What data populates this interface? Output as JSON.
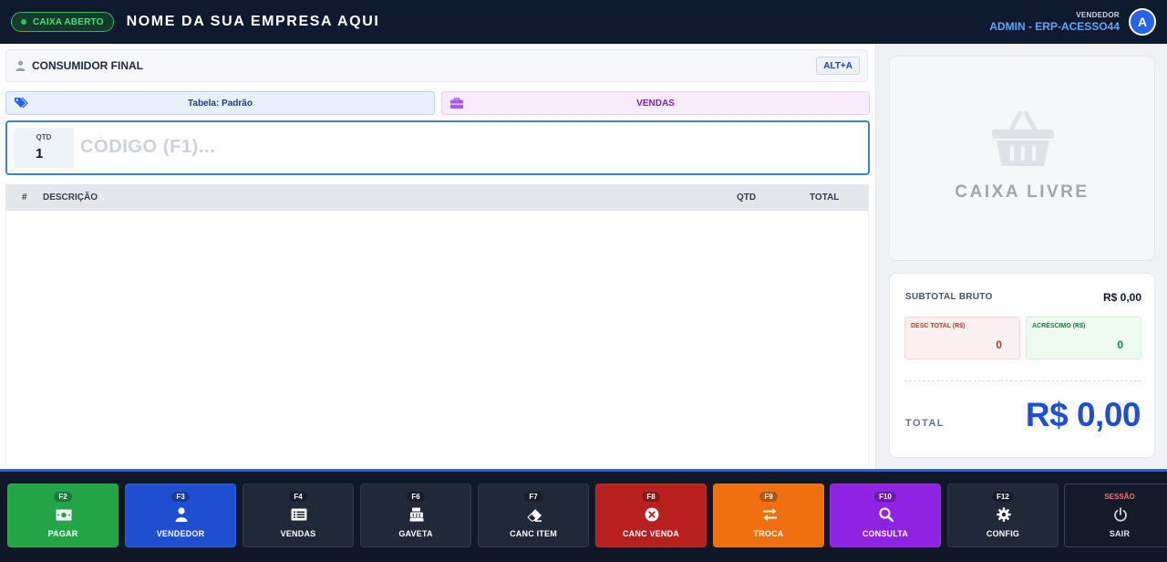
{
  "header": {
    "status_label": "CAIXA ABERTO",
    "company_name": "NOME DA SUA EMPRESA AQUI",
    "user_role": "VENDEDOR",
    "user_name": "ADMIN - ERP-ACESSO44",
    "avatar_initial": "A"
  },
  "customer": {
    "name": "CONSUMIDOR FINAL",
    "shortcut": "ALT+A"
  },
  "price_table": {
    "label": "Tabela: Padrão",
    "icon": "tags-icon"
  },
  "mode": {
    "label": "VENDAS",
    "icon": "briefcase-icon"
  },
  "entry": {
    "qty_label": "QTD",
    "qty_value": "1",
    "code_placeholder": "CÓDIGO (F1)..."
  },
  "items_table": {
    "columns": [
      "#",
      "DESCRIÇÃO",
      "QTD",
      "TOTAL"
    ],
    "rows": []
  },
  "status_panel": {
    "icon": "basket-icon",
    "label": "CAIXA LIVRE"
  },
  "totals": {
    "subtotal_label": "SUBTOTAL BRUTO",
    "subtotal_value": "R$ 0,00",
    "discount_label": "DESC TOTAL (R$)",
    "discount_value": "0",
    "surcharge_label": "ACRÉSCIMO (R$)",
    "surcharge_value": "0",
    "total_label": "TOTAL",
    "total_value": "R$ 0,00"
  },
  "function_keys": [
    {
      "key": "F2",
      "label": "PAGAR",
      "icon": "cash-icon",
      "color": "#22a447"
    },
    {
      "key": "F3",
      "label": "VENDEDOR",
      "icon": "user-icon",
      "color": "#1f4fd1"
    },
    {
      "key": "F4",
      "label": "VENDAS",
      "icon": "list-icon",
      "color": "#1f2937"
    },
    {
      "key": "F6",
      "label": "GAVETA",
      "icon": "cash-register-icon",
      "color": "#1f2937"
    },
    {
      "key": "F7",
      "label": "CANC ITEM",
      "icon": "eraser-icon",
      "color": "#1f2937"
    },
    {
      "key": "F8",
      "label": "CANC VENDA",
      "icon": "x-circle-icon",
      "color": "#b81f1f"
    },
    {
      "key": "F9",
      "label": "TROCA",
      "icon": "exchange-icon",
      "color": "#f0700f"
    },
    {
      "key": "F10",
      "label": "CONSULTA",
      "icon": "search-icon",
      "color": "#8e23e3"
    },
    {
      "key": "F12",
      "label": "CONFIG",
      "icon": "gear-icon",
      "color": "#1f2937"
    },
    {
      "key": "SESSÃO",
      "label": "SAIR",
      "icon": "power-icon",
      "color": "#131b28"
    }
  ]
}
